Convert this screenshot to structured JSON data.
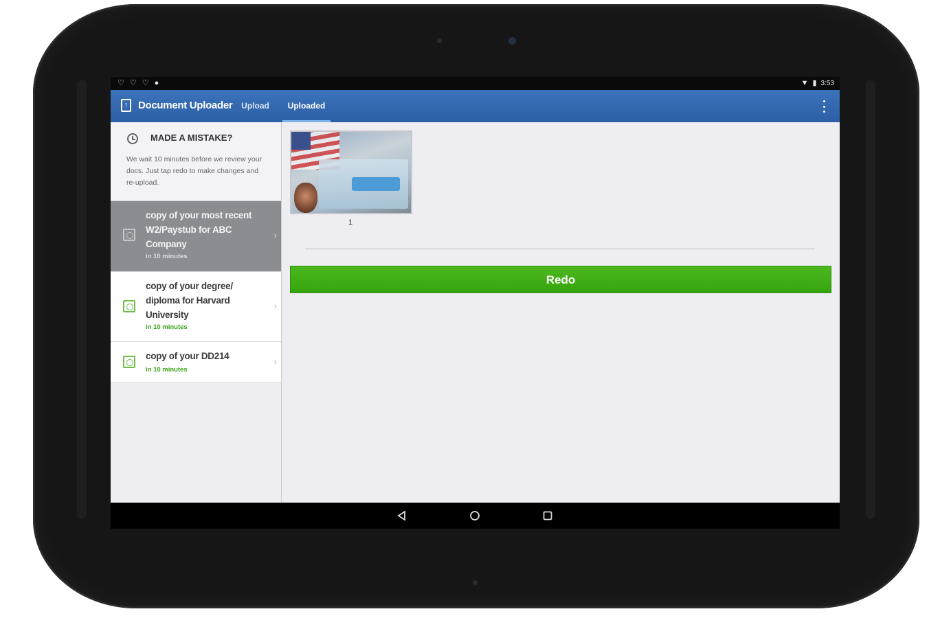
{
  "status_bar": {
    "left_icons": [
      "notification-icon",
      "notification-icon",
      "notification-icon",
      "location-icon"
    ],
    "right_icons": [
      "wifi-icon",
      "battery-icon"
    ],
    "time": "3:53"
  },
  "app_bar": {
    "icon": "document-upload-icon",
    "title": "Document Uploader",
    "tabs": [
      {
        "label": "Upload",
        "active": false
      },
      {
        "label": "Uploaded",
        "active": true
      }
    ],
    "overflow_icon": "overflow-menu-icon"
  },
  "notice": {
    "icon": "clock-icon",
    "title": "MADE A MISTAKE?",
    "body": "We wait 10 minutes before we review your docs. Just tap redo to make changes and re-upload."
  },
  "documents": [
    {
      "label": "copy of your most recent W2/Paystub for ABC Company",
      "time": "in 10 minutes",
      "selected": true
    },
    {
      "label": "copy of your degree/ diploma for Harvard University",
      "time": "in 10 minutes",
      "selected": false
    },
    {
      "label": "copy of your DD214",
      "time": "in 10 minutes",
      "selected": false
    }
  ],
  "main": {
    "thumbnail_caption": "1",
    "redo_label": "Redo"
  },
  "nav_bar": {
    "buttons": [
      "back-icon",
      "home-icon",
      "recents-icon"
    ]
  },
  "colors": {
    "app_bar": "#2c5fa5",
    "redo_button": "#3aa611",
    "time_text": "#3aa31a",
    "selected_item": "#8c8d93"
  }
}
